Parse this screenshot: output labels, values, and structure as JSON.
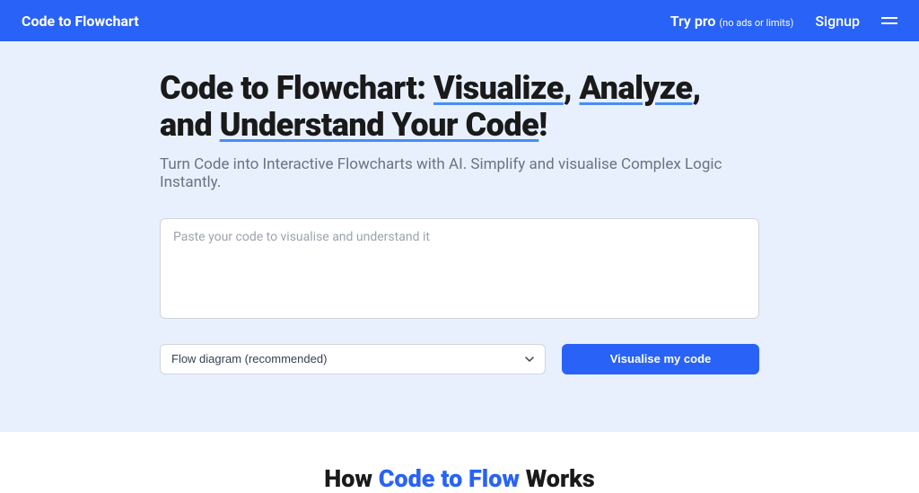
{
  "header": {
    "brand": "Code to Flowchart",
    "try_pro": "Try pro",
    "try_pro_note": "(no ads or limits)",
    "signup": "Signup"
  },
  "hero": {
    "title_pre": "Code to Flowchart: ",
    "title_u1": "Visualize",
    "title_sep1": ", ",
    "title_u2": "Analyze",
    "title_sep2": ", and ",
    "title_u3": "Understand Your Code",
    "title_end": "!",
    "subtitle": "Turn Code into Interactive Flowcharts with AI. Simplify and visualise Complex Logic Instantly."
  },
  "form": {
    "textarea_placeholder": "Paste your code to visualise and understand it",
    "select_value": "Flow diagram (recommended)",
    "button_label": "Visualise my code"
  },
  "section2": {
    "title_pre": "How ",
    "title_highlight": "Code to Flow",
    "title_post": " Works"
  }
}
